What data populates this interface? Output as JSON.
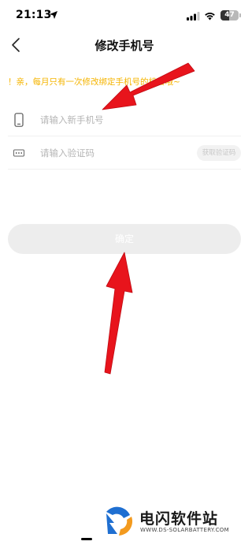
{
  "status_bar": {
    "time": "21:13",
    "battery": "47",
    "battery_level": 0.47
  },
  "header": {
    "title": "修改手机号"
  },
  "notice": {
    "text": "！亲，每月只有一次修改绑定手机号的机会哦~"
  },
  "form": {
    "phone_placeholder": "请输入新手机号",
    "code_placeholder": "请输入验证码",
    "get_code_label": "获取验证码",
    "confirm_label": "确定"
  },
  "watermark": {
    "name": "电闪软件站",
    "url": "WWW.DS-SOLARBATTERY.COM"
  },
  "colors": {
    "notice": "#f5b400",
    "arrow": "#e8141c",
    "button_disabled": "#ededed"
  },
  "icons": [
    "location-arrow-icon",
    "signal-icon",
    "wifi-icon",
    "back-icon",
    "phone-icon",
    "code-icon"
  ]
}
